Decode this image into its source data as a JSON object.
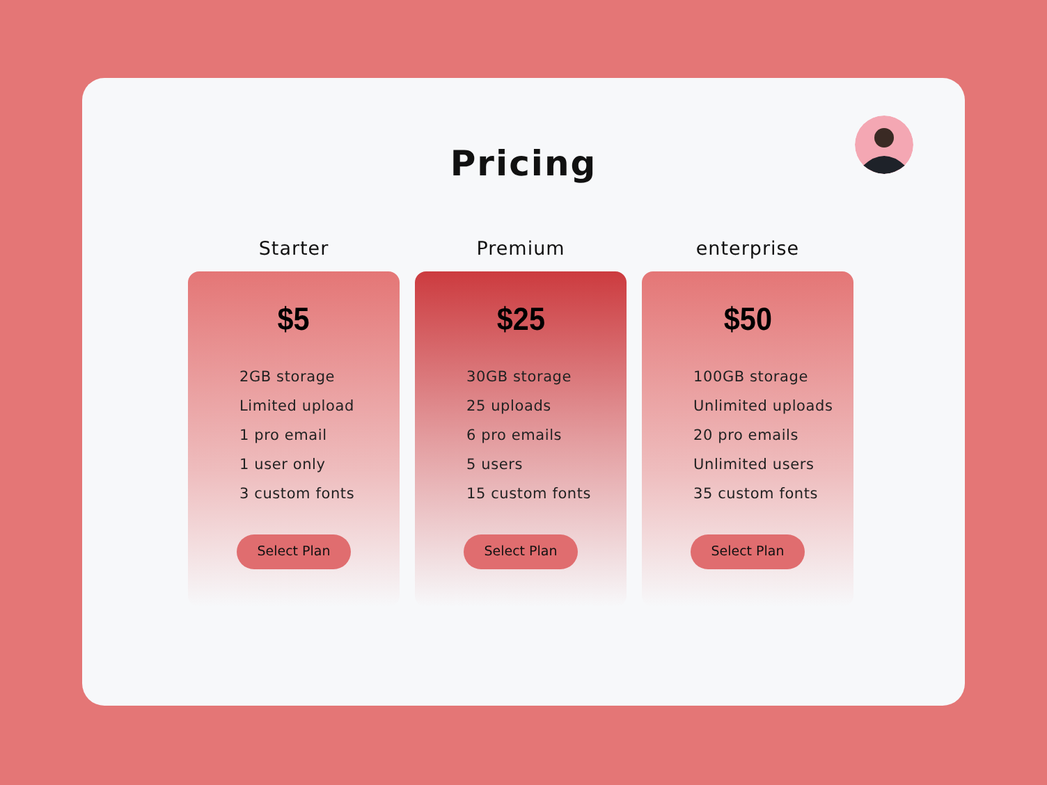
{
  "title": "Pricing",
  "plans": [
    {
      "name": "Starter",
      "price": "$5",
      "selected": false,
      "features": [
        "2GB storage",
        "Limited upload",
        "1 pro email",
        "1 user only",
        "3 custom fonts"
      ],
      "button": "Select Plan"
    },
    {
      "name": "Premium",
      "price": "$25",
      "selected": true,
      "features": [
        "30GB storage",
        "25 uploads",
        "6 pro emails",
        "5 users",
        "15 custom fonts"
      ],
      "button": "Select Plan"
    },
    {
      "name": "enterprise",
      "price": "$50",
      "selected": false,
      "features": [
        "100GB storage",
        "Unlimited uploads",
        "20 pro emails",
        "Unlimited users",
        "35 custom fonts"
      ],
      "button": "Select Plan"
    }
  ]
}
